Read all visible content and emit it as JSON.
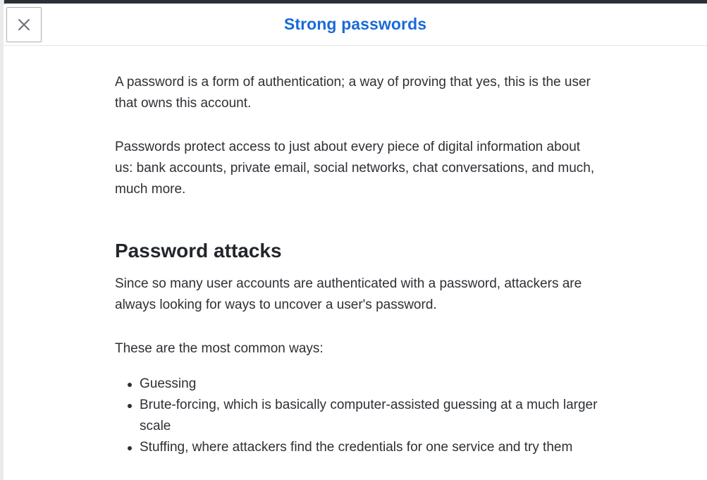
{
  "modal": {
    "title": "Strong passwords",
    "close_icon": "close-icon"
  },
  "content": {
    "paragraphs_intro": [
      "A password is a form of authentication; a way of proving that yes, this is the user that owns this account.",
      "Passwords protect access to just about every piece of digital information about us: bank accounts, private email, social networks, chat conversations, and much, much more."
    ],
    "section": {
      "heading": "Password attacks",
      "paragraph": "Since so many user accounts are authenticated with a password, attackers are always looking for ways to uncover a user's password.",
      "list_intro": "These are the most common ways:",
      "items": [
        "Guessing",
        "Brute-forcing, which is basically computer-assisted guessing at a much larger scale",
        "Stuffing, where attackers find the credentials for one service and try them"
      ]
    }
  },
  "colors": {
    "title": "#1a6ad8",
    "text": "#2d3035",
    "border": "#a9adb2"
  }
}
